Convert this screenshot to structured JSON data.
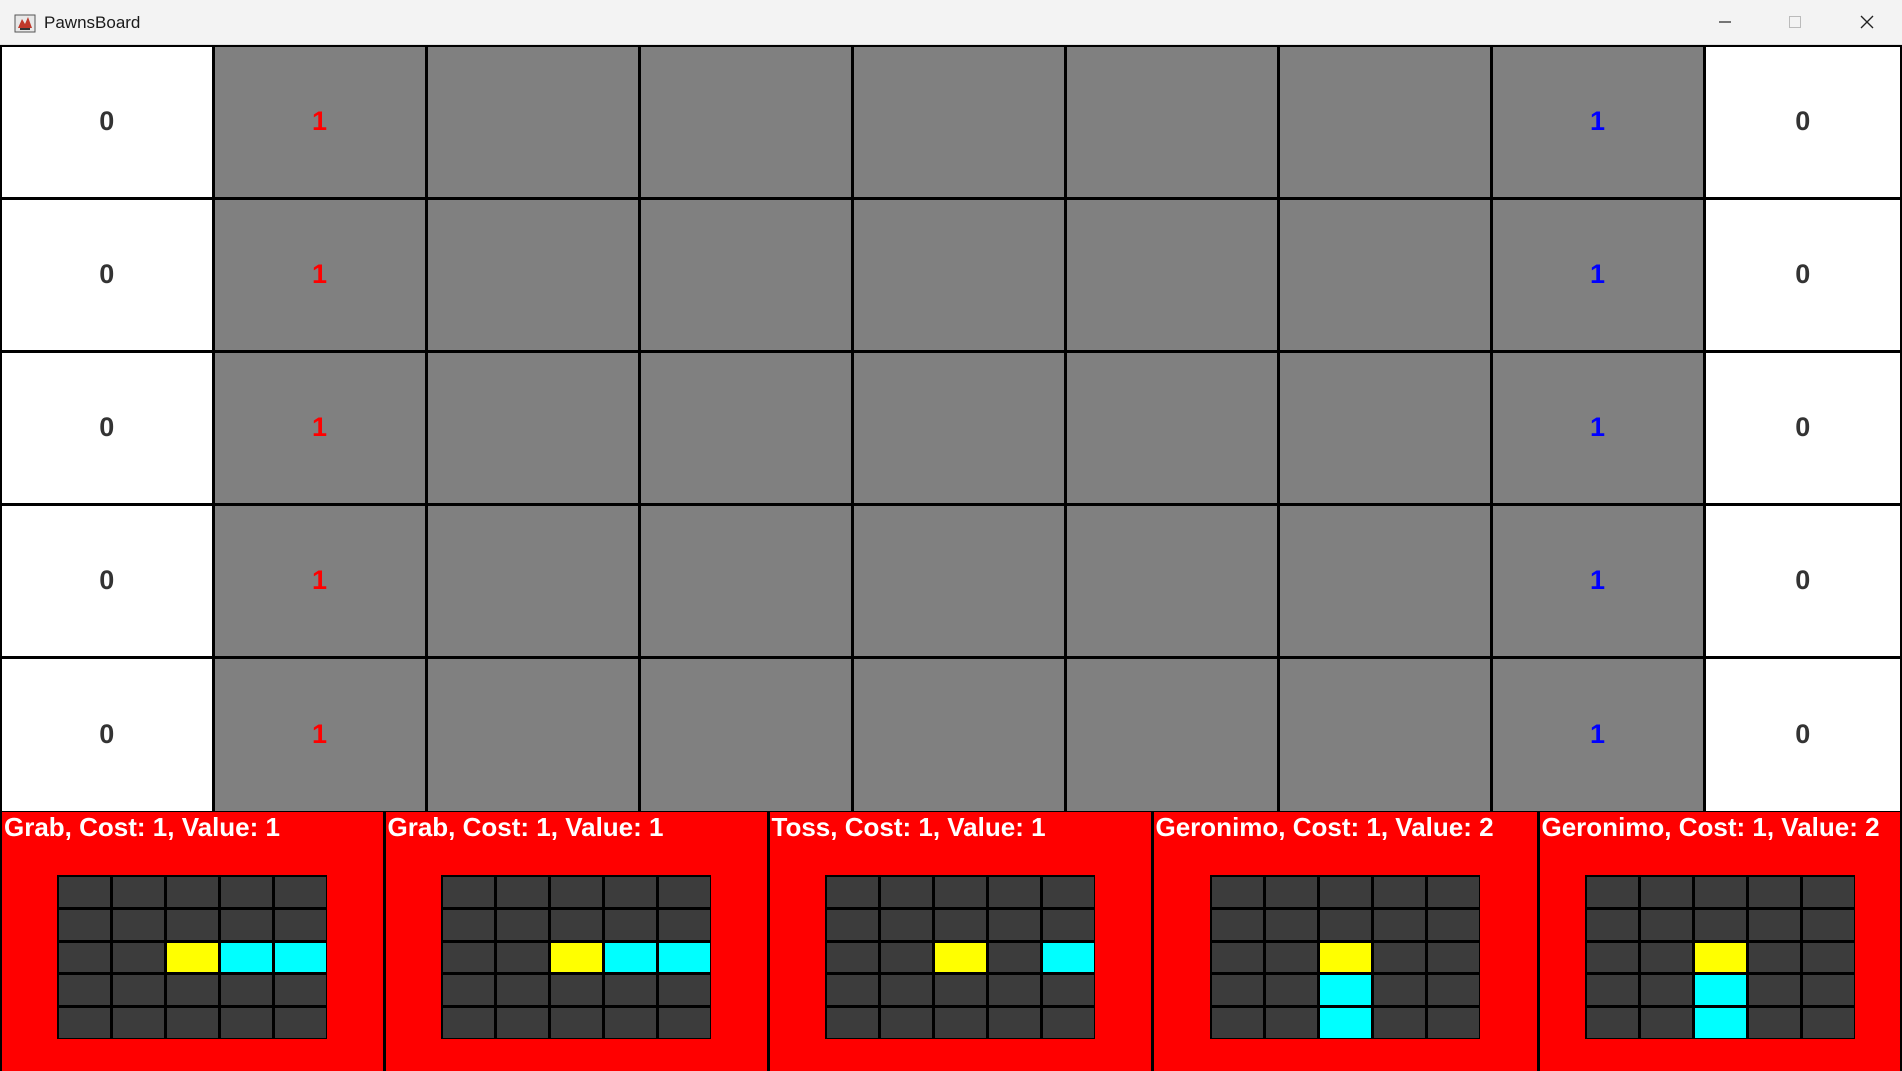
{
  "window": {
    "title": "PawnsBoard",
    "icon": "java-app-icon",
    "controls": [
      "minimize-icon",
      "maximize-icon",
      "close-icon"
    ]
  },
  "board": {
    "rows": 5,
    "left_scores": [
      "0",
      "0",
      "0",
      "0",
      "0"
    ],
    "right_scores": [
      "0",
      "0",
      "0",
      "0",
      "0"
    ],
    "cells": [
      [
        "1",
        "",
        "",
        "",
        "",
        "",
        "1"
      ],
      [
        "1",
        "",
        "",
        "",
        "",
        "",
        "1"
      ],
      [
        "1",
        "",
        "",
        "",
        "",
        "",
        "1"
      ],
      [
        "1",
        "",
        "",
        "",
        "",
        "",
        "1"
      ],
      [
        "1",
        "",
        "",
        "",
        "",
        "",
        "1"
      ]
    ],
    "cell_owner": [
      [
        "red",
        "",
        "",
        "",
        "",
        "",
        "blue"
      ],
      [
        "red",
        "",
        "",
        "",
        "",
        "",
        "blue"
      ],
      [
        "red",
        "",
        "",
        "",
        "",
        "",
        "blue"
      ],
      [
        "red",
        "",
        "",
        "",
        "",
        "",
        "blue"
      ],
      [
        "red",
        "",
        "",
        "",
        "",
        "",
        "blue"
      ]
    ]
  },
  "hand": {
    "cards": [
      {
        "title": "Grab, Cost: 1, Value: 1",
        "center": "2,2",
        "influence": [
          "2,3",
          "2,4"
        ]
      },
      {
        "title": "Grab, Cost: 1, Value: 1",
        "center": "2,2",
        "influence": [
          "2,3",
          "2,4"
        ]
      },
      {
        "title": "Toss, Cost: 1, Value: 1",
        "center": "2,2",
        "influence": [
          "2,4"
        ]
      },
      {
        "title": "Geronimo, Cost: 1, Value: 2",
        "center": "2,2",
        "influence": [
          "3,2",
          "4,2"
        ]
      },
      {
        "title": "Geronimo, Cost: 1, Value: 2",
        "center": "2,2",
        "influence": [
          "3,2",
          "4,2"
        ]
      }
    ]
  },
  "colors": {
    "red_player": "#ff0000",
    "blue_player": "#0000ff",
    "card_background": "#ff0000",
    "grid_cell": "#808080",
    "card_pawn": "#ffff00",
    "card_influence": "#00ffff"
  }
}
